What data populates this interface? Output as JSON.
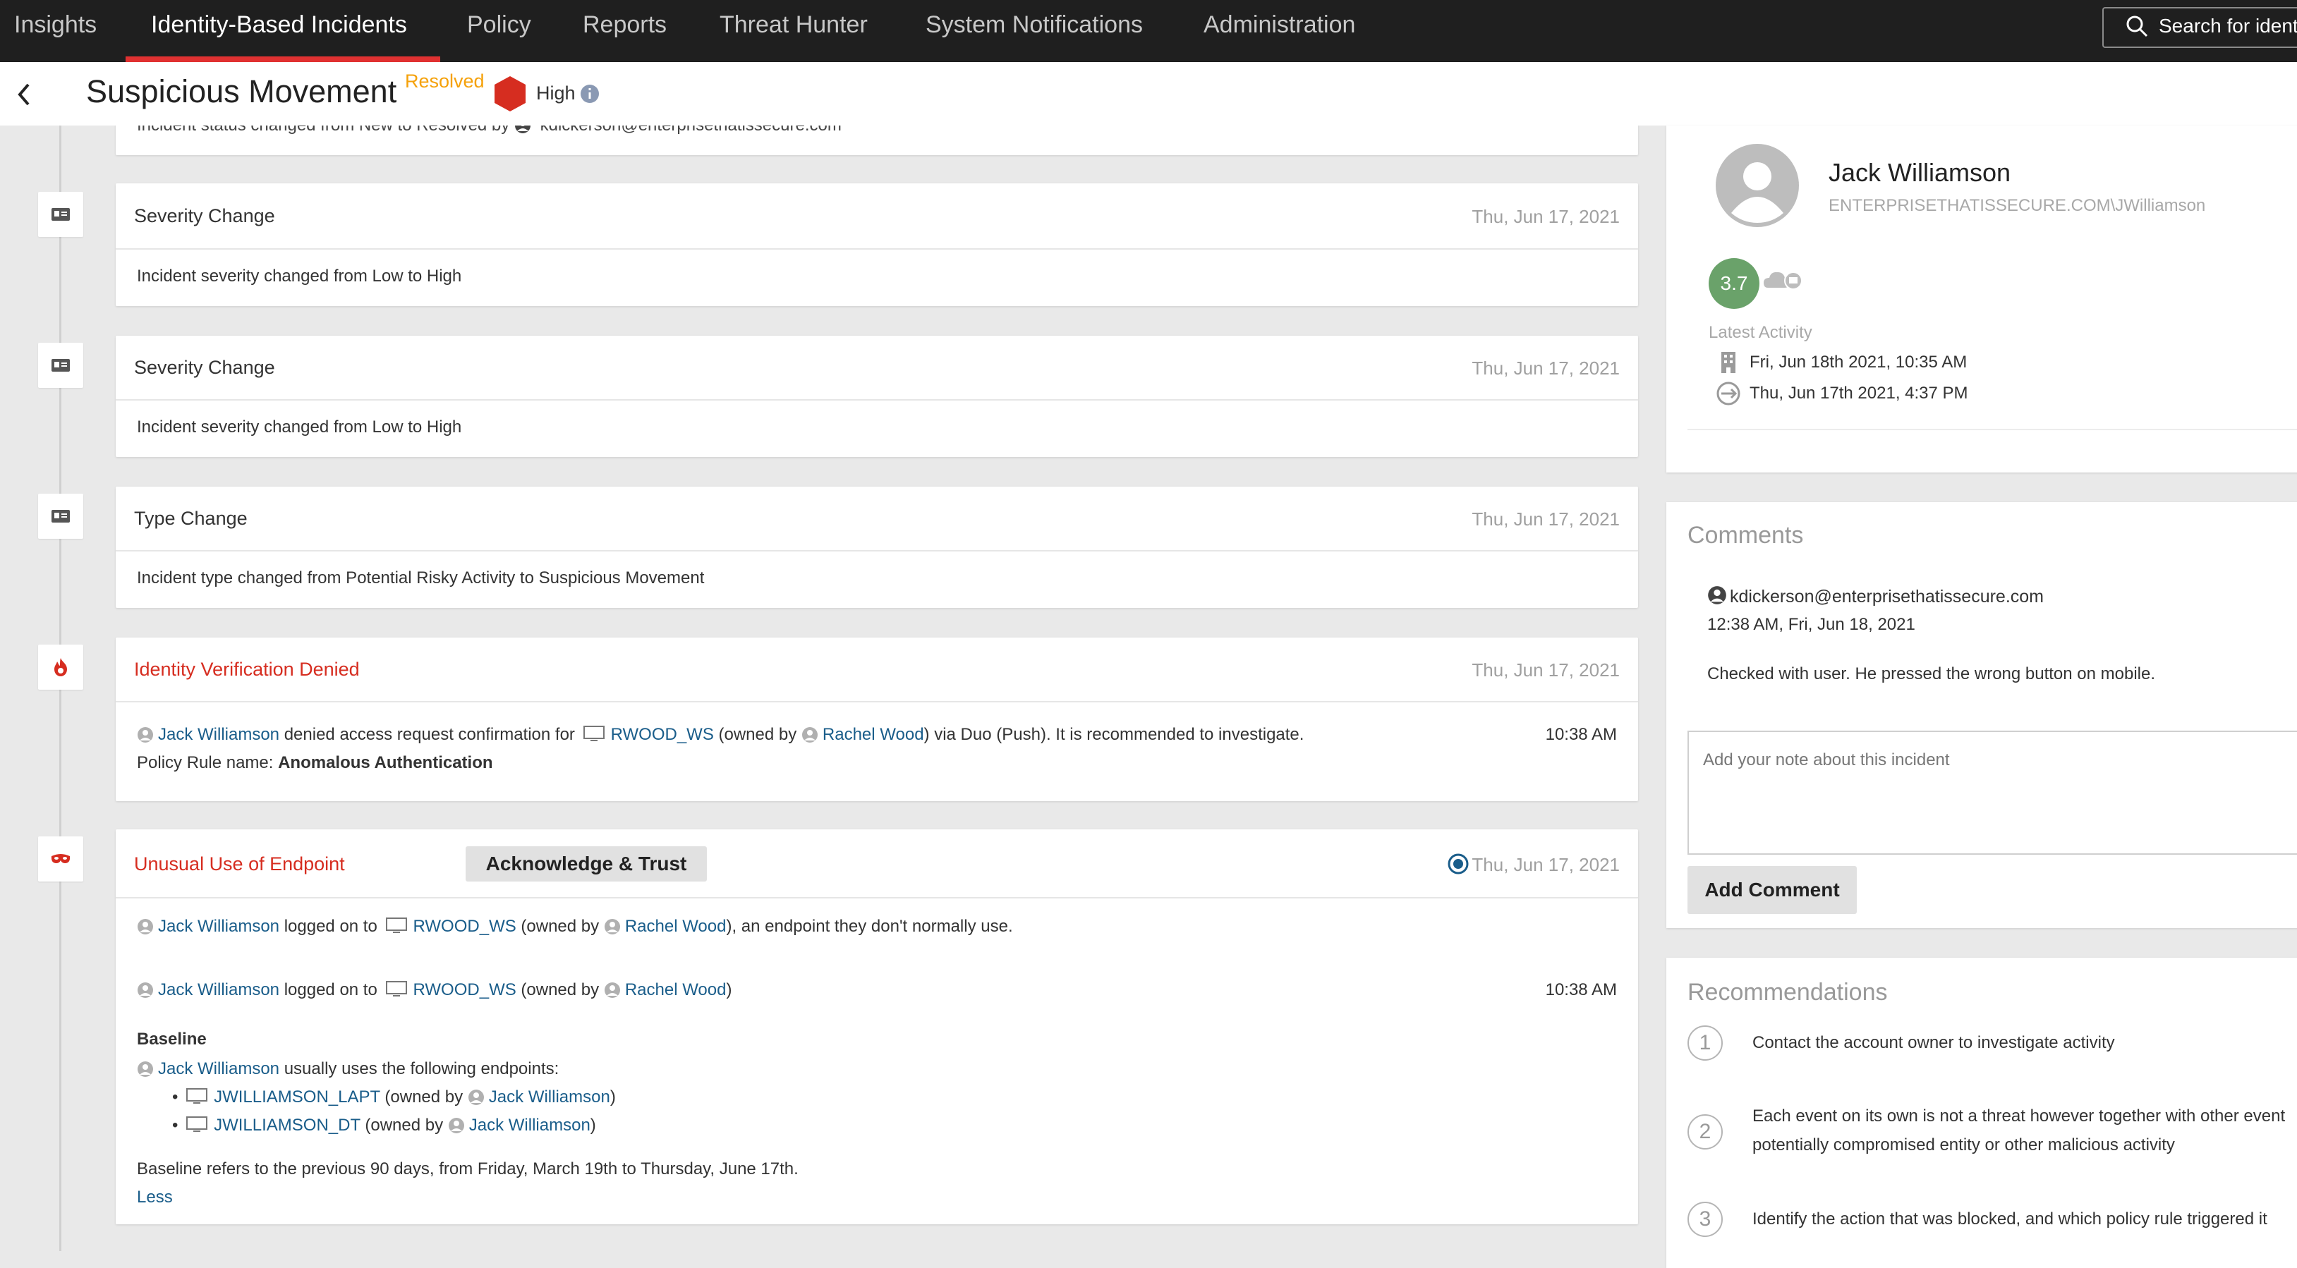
{
  "nav": {
    "items": [
      {
        "label": "Insights",
        "active": false
      },
      {
        "label": "Identity-Based Incidents",
        "active": true
      },
      {
        "label": "Policy",
        "active": false
      },
      {
        "label": "Reports",
        "active": false
      },
      {
        "label": "Threat Hunter",
        "active": false
      },
      {
        "label": "System Notifications",
        "active": false
      },
      {
        "label": "Administration",
        "active": false
      }
    ],
    "search_placeholder": "Search for identi"
  },
  "incident": {
    "title": "Suspicious Movement",
    "status": "Resolved",
    "severity": "High",
    "severity_color": "#d62d20"
  },
  "timeline": {
    "partial_entry": {
      "text": "Incident status changed from New to Resolved by",
      "user": "kdickerson@enterprisethatissecure.com"
    },
    "entries": [
      {
        "title": "Severity Change",
        "date": "Thu, Jun 17, 2021",
        "body": "Incident severity changed from Low to High"
      },
      {
        "title": "Severity Change",
        "date": "Thu, Jun 17, 2021",
        "body": "Incident severity changed from Low to High"
      },
      {
        "title": "Type Change",
        "date": "Thu, Jun 17, 2021",
        "body": "Incident type changed from Potential Risky Activity to Suspicious Movement"
      }
    ],
    "denied": {
      "title": "Identity Verification Denied",
      "date": "Thu, Jun 17, 2021",
      "user": "Jack Williamson",
      "text1": "denied access request confirmation for",
      "endpoint": "RWOOD_WS",
      "owned_by_prefix": "(owned by",
      "owner": "Rachel Wood",
      "text2": ") via Duo (Push). It is recommended to investigate.",
      "time": "10:38 AM",
      "rule_label": "Policy Rule name:",
      "rule_name": "Anomalous Authentication"
    },
    "unusual": {
      "title": "Unusual Use of Endpoint",
      "button": "Acknowledge & Trust",
      "date": "Thu, Jun 17, 2021",
      "line1": {
        "user": "Jack Williamson",
        "text": "logged on to",
        "endpoint": "RWOOD_WS",
        "owned_by_prefix": "(owned by",
        "owner": "Rachel Wood",
        "suffix": "), an endpoint they don't normally use."
      },
      "line2": {
        "user": "Jack Williamson",
        "text": "logged on to",
        "endpoint": "RWOOD_WS",
        "owned_by_prefix": "(owned by",
        "owner": "Rachel Wood",
        "suffix": ")",
        "time": "10:38 AM"
      },
      "baseline_title": "Baseline",
      "baseline_user": "Jack Williamson",
      "baseline_text": "usually uses the following endpoints:",
      "endpoints": [
        {
          "name": "JWILLIAMSON_LAPT",
          "owned_by_prefix": "(owned by",
          "owner": "Jack Williamson",
          "suffix": ")"
        },
        {
          "name": "JWILLIAMSON_DT",
          "owned_by_prefix": "(owned by",
          "owner": "Jack Williamson",
          "suffix": ")"
        }
      ],
      "baseline_note": "Baseline refers to the previous 90 days, from Friday, March 19th to Thursday, June 17th.",
      "less_link": "Less"
    }
  },
  "user_panel": {
    "name": "Jack Williamson",
    "domain": "ENTERPRISETHATISSECURE.COM\\JWilliamson",
    "risk_score": "3.7",
    "latest_activity_label": "Latest Activity",
    "activity": [
      {
        "icon": "building-icon",
        "text": "Fri, Jun 18th 2021, 10:35 AM"
      },
      {
        "icon": "cloud-sync-icon",
        "text": "Thu, Jun 17th 2021, 4:37 PM"
      }
    ]
  },
  "comments": {
    "title": "Comments",
    "items": [
      {
        "author": "kdickerson@enterprisethatissecure.com",
        "time": "12:38 AM, Fri, Jun 18, 2021",
        "text": "Checked with user. He pressed the wrong button on mobile."
      }
    ],
    "placeholder": "Add your note about this incident",
    "add_button": "Add Comment"
  },
  "recommendations": {
    "title": "Recommendations",
    "items": [
      {
        "num": "1",
        "lines": [
          "Contact the account owner to investigate activity"
        ]
      },
      {
        "num": "2",
        "lines": [
          "Each event on its own is not a threat however together with other event",
          "potentially compromised entity or other malicious activity"
        ]
      },
      {
        "num": "3",
        "lines": [
          "Identify the action that was blocked, and which policy rule triggered it"
        ]
      }
    ]
  }
}
